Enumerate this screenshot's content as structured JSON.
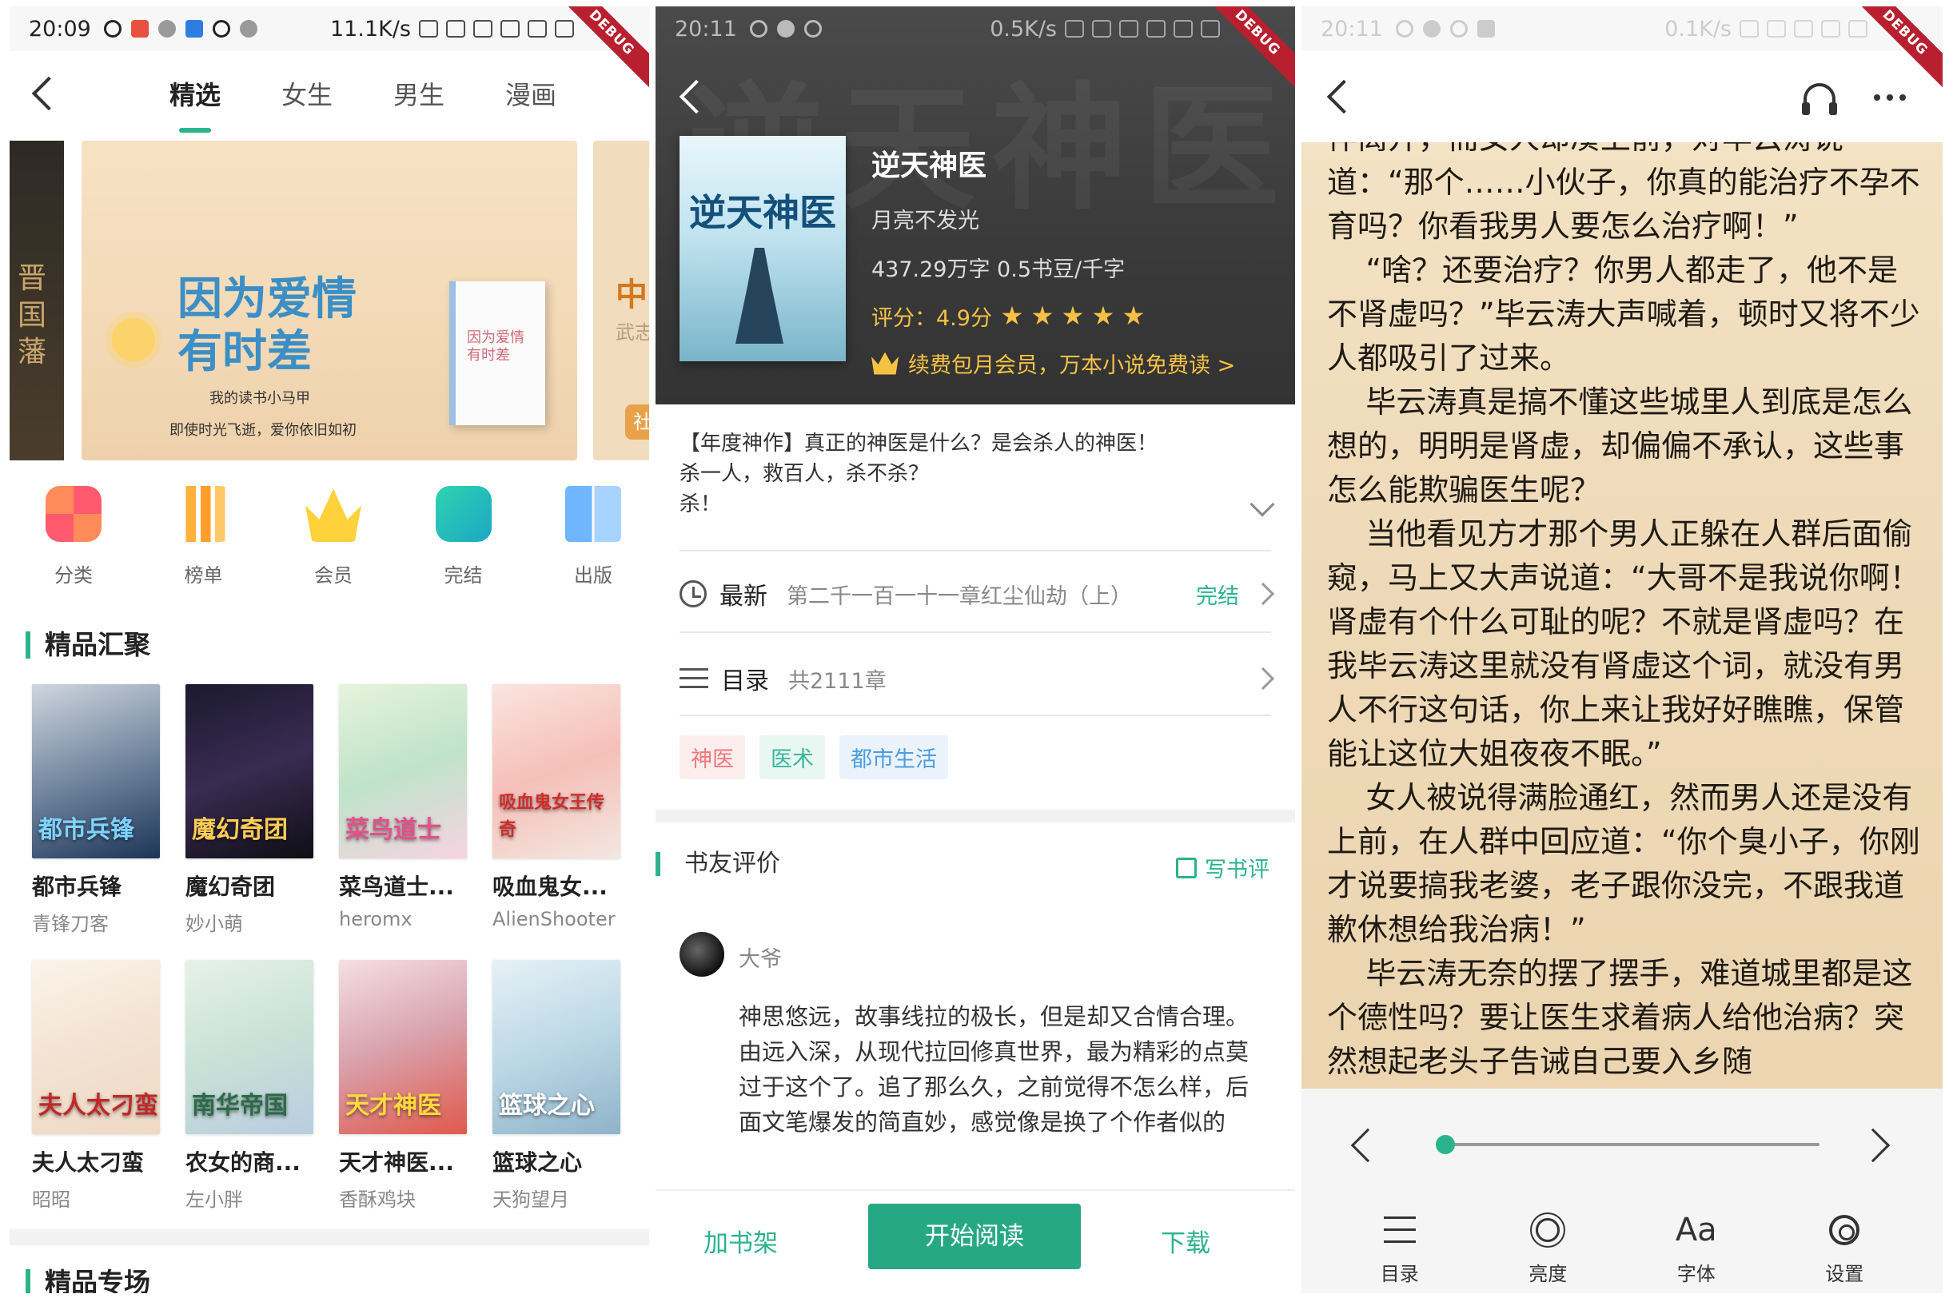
{
  "panel1": {
    "status": {
      "time": "20:09",
      "net": "11.1K/s"
    },
    "debug": "DEBUG",
    "tabs": [
      "精选",
      "女生",
      "男生",
      "漫画"
    ],
    "banner": {
      "left_text": "晋\n国\n藩",
      "title": "因为爱情\n有时差",
      "author_line": "我的读书小马甲",
      "slogan": "即使时光飞逝，爱你依旧如初",
      "book_text": "因为爱情\n有时差",
      "right_big": "中",
      "right_small": "武志",
      "right_badge": "社"
    },
    "categories": [
      "分类",
      "榜单",
      "会员",
      "完结",
      "出版"
    ],
    "section_title": "精品汇聚",
    "books": [
      {
        "title": "都市兵锋",
        "author": "青锋刀客",
        "cover_text": "都市兵锋"
      },
      {
        "title": "魔幻奇团",
        "author": "妙小萌",
        "cover_text": "魔幻奇团"
      },
      {
        "title": "菜鸟道士...",
        "author": "heromx",
        "cover_text": "菜鸟道士"
      },
      {
        "title": "吸血鬼女...",
        "author": "AlienShooter",
        "cover_text": "吸血鬼女王传奇"
      },
      {
        "title": "夫人太刁蛮",
        "author": "昭昭",
        "cover_text": "夫人太刁蛮"
      },
      {
        "title": "农女的商...",
        "author": "左小胖",
        "cover_text": "南华帝国"
      },
      {
        "title": "天才神医...",
        "author": "香酥鸡块",
        "cover_text": "天才神医"
      },
      {
        "title": "篮球之心",
        "author": "天狗望月",
        "cover_text": "篮球之心"
      }
    ],
    "section2_title": "精品专场"
  },
  "panel2": {
    "status": {
      "time": "20:11",
      "net": "0.5K/s"
    },
    "debug": "DEBUG",
    "book": {
      "title": "逆天神医",
      "author": "月亮不发光",
      "words": "437.29万字 0.5书豆/千字",
      "rating": "评分：4.9分",
      "member": "续费包月会员，万本小说免费读 >",
      "cover_text": "逆天神医"
    },
    "intro": "【年度神作】真正的神医是什么？是会杀人的神医！\n杀一人，救百人，杀不杀？\n杀！",
    "latest": {
      "label": "最新",
      "chapter": "第二千一百一十一章红尘仙劫（上）",
      "status": "完结"
    },
    "toc": {
      "label": "目录",
      "count": "共2111章"
    },
    "tags": [
      "神医",
      "医术",
      "都市生活"
    ],
    "reviews_title": "书友评价",
    "write_review": "写书评",
    "review": {
      "user": "大爷",
      "text": "神思悠远，故事线拉的极长，但是却又合情合理。由远入深，从现代拉回修真世界，最为精彩的点莫过于这个了。追了那么久，之前觉得不怎么样，后面文笔爆发的简直妙，感觉像是换了个作者似的"
    },
    "bottom": {
      "add": "加书架",
      "read": "开始阅读",
      "download": "下载"
    }
  },
  "panel3": {
    "status": {
      "time": "20:11",
      "net": "0.1K/s"
    },
    "debug": "DEBUG",
    "text": "伴离开，而女人却凑上前，对毕云涛说道：“那个……小伙子，你真的能治疗不孕不育吗？你看我男人要怎么治疗啊！”\n    “啥？还要治疗？你男人都走了，他不是不肾虚吗？”毕云涛大声喊着，顿时又将不少人都吸引了过来。\n    毕云涛真是搞不懂这些城里人到底是怎么想的，明明是肾虚，却偏偏不承认，这些事怎么能欺骗医生呢？\n    当他看见方才那个男人正躲在人群后面偷窥，马上又大声说道：“大哥不是我说你啊！肾虚有个什么可耻的呢？不就是肾虚吗？在我毕云涛这里就没有肾虚这个词，就没有男人不行这句话，你上来让我好好瞧瞧，保管能让这位大姐夜夜不眠。”\n    女人被说得满脸通红，然而男人还是没有上前，在人群中回应道：“你个臭小子，你刚才说要搞我老婆，老子跟你没完，不跟我道歉休想给我治病！”\n    毕云涛无奈的摆了摆手，难道城里都是这个德性吗？要让医生求着病人给他治病？突然想起老头子告诫自己要入乡随",
    "progress": 0.0,
    "tools": [
      "目录",
      "亮度",
      "字体",
      "设置"
    ],
    "font_icon": "Aa"
  }
}
